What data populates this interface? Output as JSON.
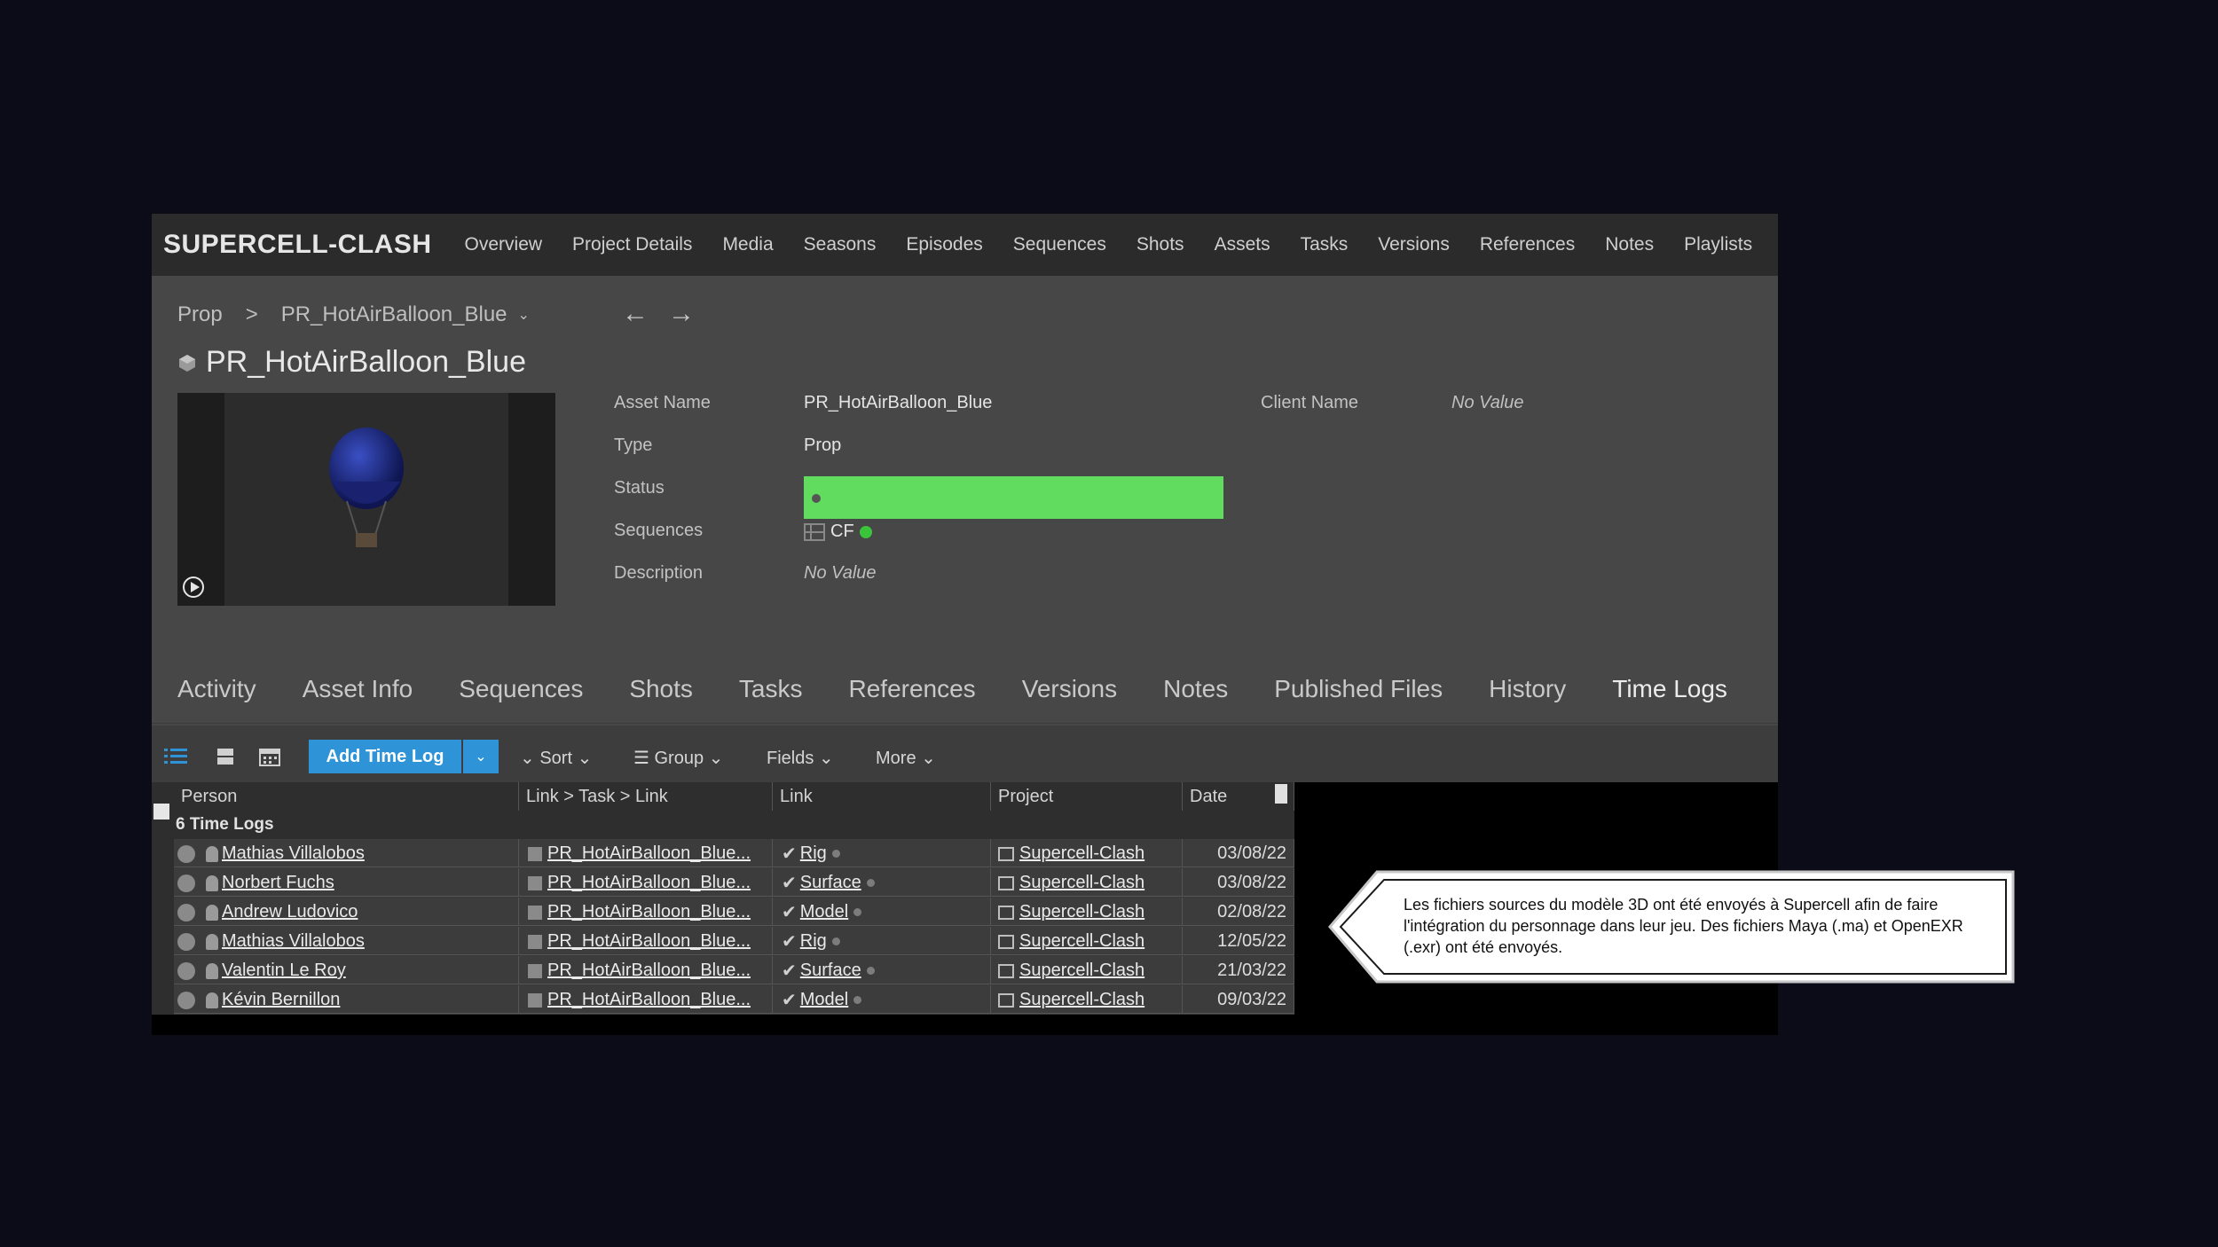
{
  "nav": {
    "brand": "SUPERCELL-CLASH",
    "items": [
      "Overview",
      "Project Details",
      "Media",
      "Seasons",
      "Episodes",
      "Sequences",
      "Shots",
      "Assets",
      "Tasks",
      "Versions",
      "References",
      "Notes",
      "Playlists"
    ]
  },
  "breadcrumb": {
    "type": "Prop",
    "separator": ">",
    "asset": "PR_HotAirBalloon_Blue"
  },
  "asset": {
    "title": "PR_HotAirBalloon_Blue",
    "fields": {
      "asset_name_label": "Asset Name",
      "asset_name": "PR_HotAirBalloon_Blue",
      "type_label": "Type",
      "type": "Prop",
      "status_label": "Status",
      "status_color": "#62dc5f",
      "sequences_label": "Sequences",
      "sequences": "CF",
      "description_label": "Description",
      "description": "No Value",
      "client_name_label": "Client Name",
      "client_name": "No Value"
    }
  },
  "tabs": [
    "Activity",
    "Asset Info",
    "Sequences",
    "Shots",
    "Tasks",
    "References",
    "Versions",
    "Notes",
    "Published Files",
    "History",
    "Time Logs"
  ],
  "active_tab": "Time Logs",
  "toolbar": {
    "add_label": "Add Time Log",
    "sort": "Sort",
    "group": "Group",
    "fields": "Fields",
    "more": "More"
  },
  "table": {
    "columns": [
      "Person",
      "Link > Task > Link",
      "Link",
      "Project",
      "Date"
    ],
    "group_label": "6 Time Logs",
    "rows": [
      {
        "person": "Mathias Villalobos",
        "entity": "PR_HotAirBalloon_Blue...",
        "task": "Rig",
        "project": "Supercell-Clash",
        "date": "03/08/22"
      },
      {
        "person": "Norbert Fuchs",
        "entity": "PR_HotAirBalloon_Blue...",
        "task": "Surface",
        "project": "Supercell-Clash",
        "date": "03/08/22"
      },
      {
        "person": "Andrew Ludovico",
        "entity": "PR_HotAirBalloon_Blue...",
        "task": "Model",
        "project": "Supercell-Clash",
        "date": "02/08/22"
      },
      {
        "person": "Mathias Villalobos",
        "entity": "PR_HotAirBalloon_Blue...",
        "task": "Rig",
        "project": "Supercell-Clash",
        "date": "12/05/22"
      },
      {
        "person": "Valentin Le Roy",
        "entity": "PR_HotAirBalloon_Blue...",
        "task": "Surface",
        "project": "Supercell-Clash",
        "date": "21/03/22"
      },
      {
        "person": "Kévin Bernillon",
        "entity": "PR_HotAirBalloon_Blue...",
        "task": "Model",
        "project": "Supercell-Clash",
        "date": "09/03/22"
      }
    ]
  },
  "callout": {
    "text": "Les fichiers sources du modèle 3D ont été envoyés à Supercell afin de faire l'intégration du personnage dans leur jeu. Des fichiers Maya (.ma) et OpenEXR (.exr) ont été envoyés."
  }
}
